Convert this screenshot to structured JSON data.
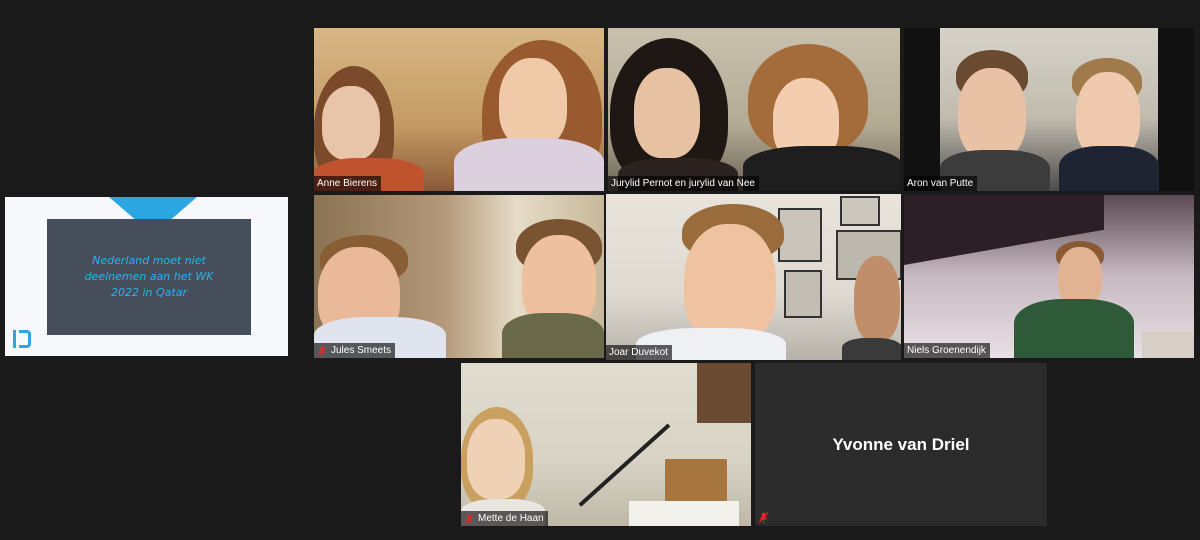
{
  "presentation": {
    "slide_text": "Nederland moet niet deelnemen aan het WK 2022 in Qatar"
  },
  "participants": [
    {
      "name": "Anne Bierens",
      "muted": false
    },
    {
      "name": "Jurylid Pernot en jurylid van Nee",
      "muted": false
    },
    {
      "name": "Aron van Putte",
      "muted": false
    },
    {
      "name": "Jules Smeets",
      "muted": true
    },
    {
      "name": "Joar Duvekot",
      "muted": false,
      "active_speaker": true
    },
    {
      "name": "Niels Groenendijk",
      "muted": false
    },
    {
      "name": "Mette de Haan",
      "muted": true
    },
    {
      "name": "Yvonne van Driel",
      "muted": true,
      "video_off": true
    }
  ],
  "colors": {
    "background": "#1a1a1a",
    "active_speaker_border": "#b9e36f",
    "muted_icon": "#e02b2b",
    "slide_accent": "#2ba6e0"
  },
  "icons": {
    "muted": "microphone-muted-icon",
    "logo": "presentation-logo-icon"
  }
}
